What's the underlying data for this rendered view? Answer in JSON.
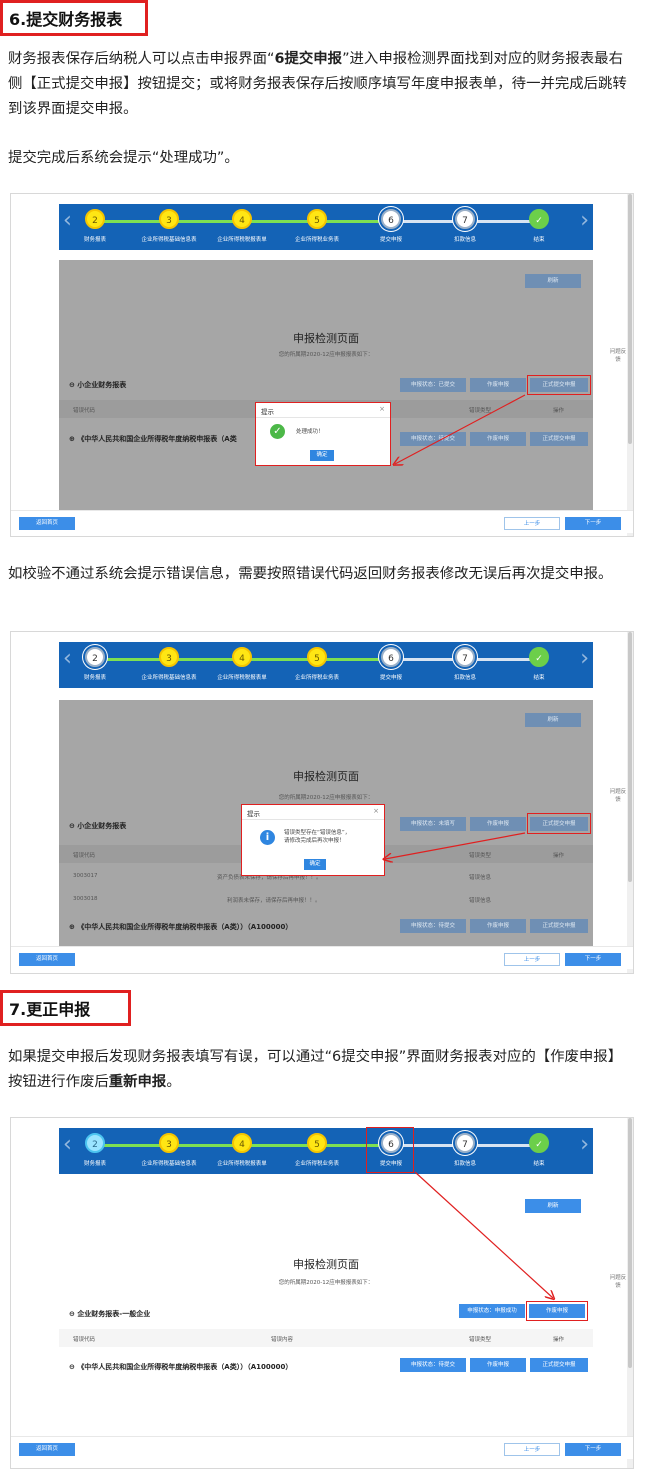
{
  "sec6": {
    "heading": "6.提交财务报表",
    "p1_a": "财务报表保存后纳税人可以点击申报界面“",
    "p1_b": "6提交申报",
    "p1_c": "”进入申报检测界面找到对应的财务报表最右侧【正式提交申报】按钮提交；或将财务报表保存后按顺序填写年度申报表单，待一并完成后跳转到该界面提交申报。",
    "p2": "提交完成后系统会提示“处理成功”。",
    "p3": "如校验不通过系统会提示错误信息，需要按照错误代码返回财务报表修改无误后再次提交申报。"
  },
  "sec7": {
    "heading": "7.更正申报",
    "p1_a": "如果提交申报后发现财务报表填写有误，可以通过“6提交申报”界面财务报表对应的【作废申报】按钮进行作废后",
    "p1_b": "重新申报",
    "p1_c": "。"
  },
  "steps": {
    "nums": [
      "2",
      "3",
      "4",
      "5",
      "6",
      "7",
      "✓"
    ],
    "labels": [
      "财务报表",
      "企业所得税基础信息表",
      "企业所得税税报表单",
      "企业所得税业务表",
      "提交申报",
      "扣款信息",
      "结束"
    ]
  },
  "ui": {
    "refresh": "刷新",
    "page_title": "申报检测页面",
    "page_sub": "您的所属期2020-12应申报报表如下：",
    "side_feedback": "问题反馈",
    "col_code": "错误代码",
    "col_content": "错误内容",
    "col_type": "错误类型",
    "col_op": "操作",
    "return_home": "返回首页",
    "prev": "上一步",
    "next": "下一步",
    "void_btn": "作废申报",
    "submit_btn": "正式提交申报",
    "main_form": "《中华人民共和国企业所得税年度纳税申报表（A类））（A100000）",
    "main_form_short": "《中华人民共和国企业所得税年度纳税申报表（A类",
    "status_submitted": "申报状态：待提交"
  },
  "shot1": {
    "section": "小企业财务报表",
    "status": "申报状态：已提交",
    "dialog_title": "提示",
    "dialog_msg": "处理成功！",
    "dialog_ok": "确定"
  },
  "shot2": {
    "section": "小企业财务报表",
    "status": "申报状态：未填写",
    "dialog_title": "提示",
    "dialog_msg1": "错误类型存在“错误信息”，",
    "dialog_msg2": "请修改完成后再次申报！",
    "dialog_ok": "确定",
    "rows": [
      {
        "code": "3003017",
        "content": "资产负债表未保存，请保存后再申报！！。",
        "type": "错误信息"
      },
      {
        "code": "3003018",
        "content": "利润表未保存，请保存后再申报！！。",
        "type": "错误信息"
      }
    ]
  },
  "shot3": {
    "section": "企业财务报表-一般企业",
    "status": "申报状态：申报成功"
  }
}
